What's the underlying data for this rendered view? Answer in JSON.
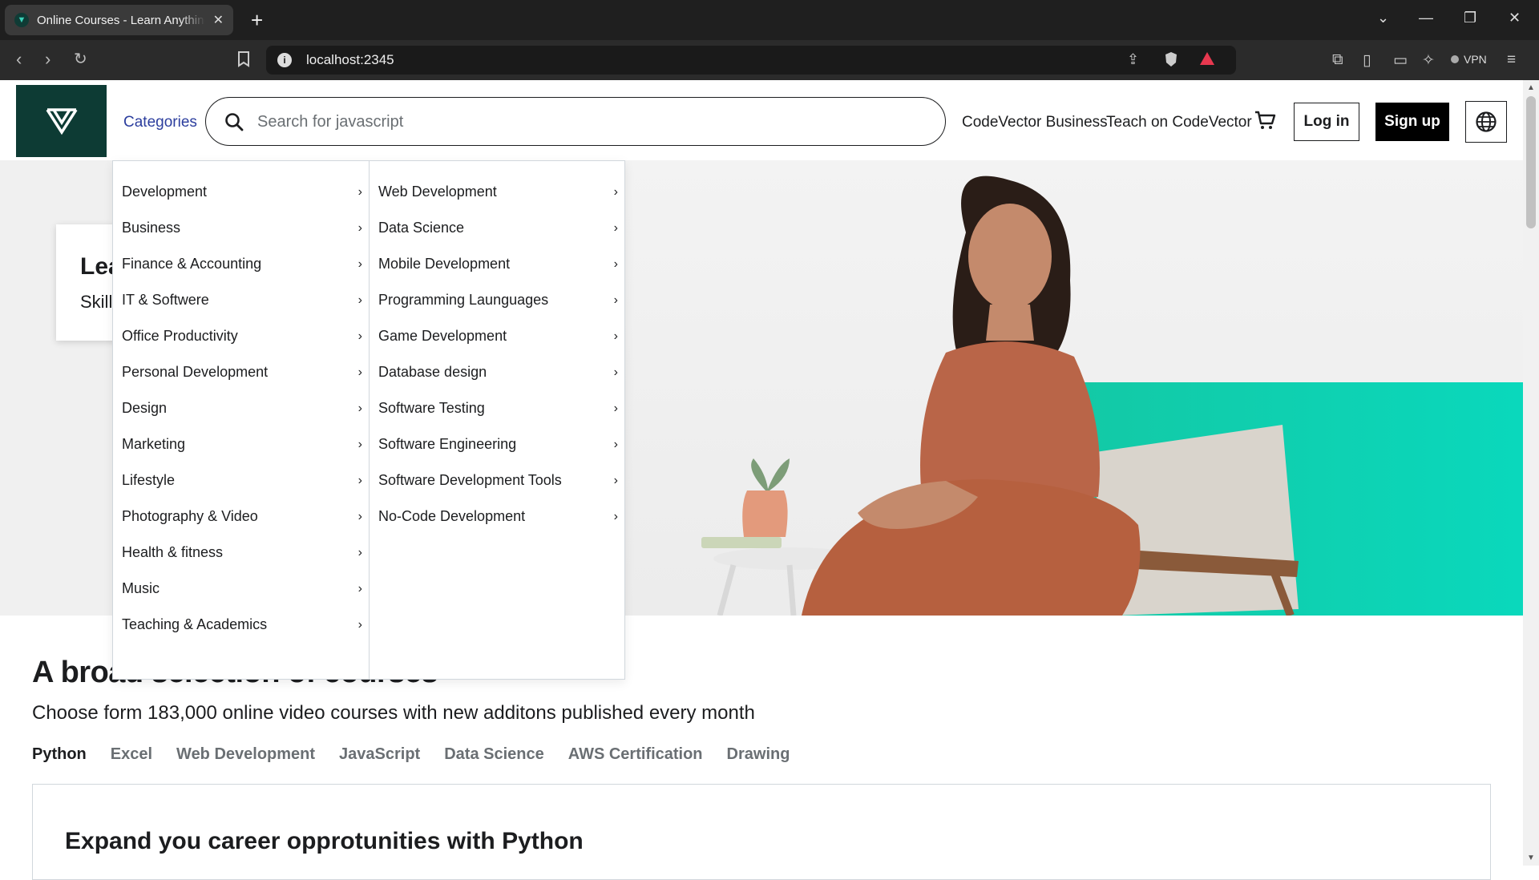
{
  "browser": {
    "tab_title": "Online Courses - Learn Anything",
    "url": "localhost:2345",
    "vpn_label": "VPN"
  },
  "header": {
    "categories_label": "Categories",
    "search_placeholder": "Search for javascript",
    "business_link": "CodeVector Business",
    "teach_link": "Teach on CodeVector",
    "login_label": "Log in",
    "signup_label": "Sign up"
  },
  "hero": {
    "card_title": "Lea",
    "card_subtitle": "Skill"
  },
  "menu": {
    "categories": [
      {
        "label": "Development"
      },
      {
        "label": "Business"
      },
      {
        "label": "Finance & Accounting"
      },
      {
        "label": "IT & Softwere"
      },
      {
        "label": "Office Productivity"
      },
      {
        "label": "Personal Development"
      },
      {
        "label": "Design"
      },
      {
        "label": "Marketing"
      },
      {
        "label": "Lifestyle"
      },
      {
        "label": "Photography & Video"
      },
      {
        "label": "Health & fitness"
      },
      {
        "label": "Music"
      },
      {
        "label": "Teaching & Academics"
      }
    ],
    "subcategories": [
      {
        "label": "Web Development"
      },
      {
        "label": "Data Science"
      },
      {
        "label": "Mobile Development"
      },
      {
        "label": "Programming Launguages"
      },
      {
        "label": "Game Development"
      },
      {
        "label": "Database design"
      },
      {
        "label": "Software Testing"
      },
      {
        "label": "Software Engineering"
      },
      {
        "label": "Software Development Tools"
      },
      {
        "label": "No-Code Development"
      }
    ]
  },
  "courses": {
    "title": "A broad selection of courses",
    "subtitle": "Choose form 183,000 online video courses with new additons published every month",
    "tabs": [
      "Python",
      "Excel",
      "Web Development",
      "JavaScript",
      "Data Science",
      "AWS Certification",
      "Drawing"
    ],
    "active_tab": "Python",
    "box_title": "Expand you career opprotunities with Python"
  },
  "colors": {
    "brand_dark": "#0d3b34",
    "accent_teal": "#13c9a6",
    "link_blue": "#2c3e9e"
  }
}
